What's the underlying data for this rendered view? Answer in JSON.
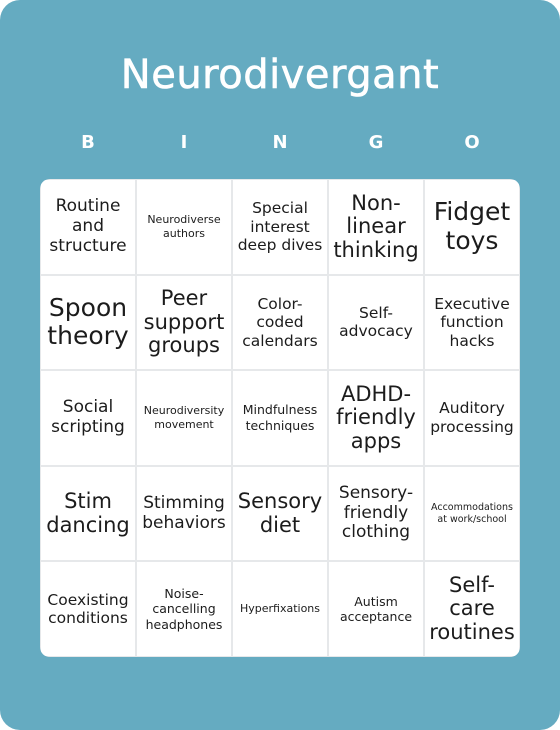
{
  "card": {
    "title": "Neurodivergant",
    "background_color": "#65abc1",
    "header_letters": [
      "B",
      "I",
      "N",
      "G",
      "O"
    ]
  },
  "board": {
    "rows": [
      [
        {
          "text": "Routine and structure",
          "size": "m"
        },
        {
          "text": "Neurodiverse authors",
          "size": "xs"
        },
        {
          "text": "Special interest deep dives",
          "size": "ms"
        },
        {
          "text": "Non-linear thinking",
          "size": "l"
        },
        {
          "text": "Fidget toys",
          "size": "xl"
        }
      ],
      [
        {
          "text": "Spoon theory",
          "size": "xl"
        },
        {
          "text": "Peer support groups",
          "size": "l"
        },
        {
          "text": "Color-coded calendars",
          "size": "ms"
        },
        {
          "text": "Self-advocacy",
          "size": "ms"
        },
        {
          "text": "Executive function hacks",
          "size": "ms"
        }
      ],
      [
        {
          "text": "Social scripting",
          "size": "m"
        },
        {
          "text": "Neurodiversity movement",
          "size": "xs"
        },
        {
          "text": "Mindfulness techniques",
          "size": "s"
        },
        {
          "text": "ADHD-friendly apps",
          "size": "l"
        },
        {
          "text": "Auditory processing",
          "size": "ms"
        }
      ],
      [
        {
          "text": "Stim dancing",
          "size": "l"
        },
        {
          "text": "Stimming behaviors",
          "size": "m"
        },
        {
          "text": "Sensory diet",
          "size": "l"
        },
        {
          "text": "Sensory-friendly clothing",
          "size": "m"
        },
        {
          "text": "Accommodations at work/school",
          "size": "xxs"
        }
      ],
      [
        {
          "text": "Coexisting conditions",
          "size": "ms"
        },
        {
          "text": "Noise-cancelling headphones",
          "size": "s"
        },
        {
          "text": "Hyperfixations",
          "size": "xs"
        },
        {
          "text": "Autism acceptance",
          "size": "s"
        },
        {
          "text": "Self-care routines",
          "size": "l"
        }
      ]
    ]
  }
}
